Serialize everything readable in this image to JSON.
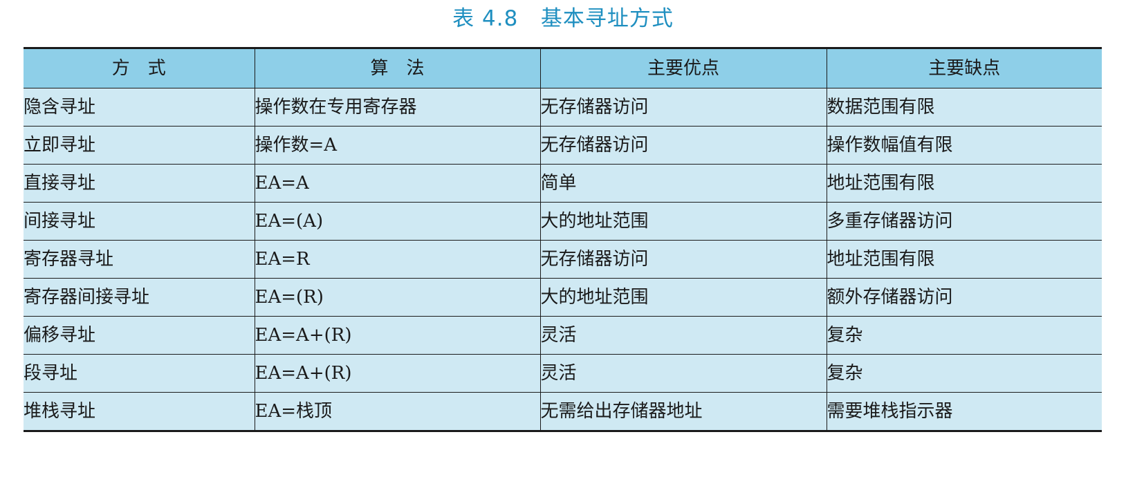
{
  "caption": "表 4.8   基本寻址方式",
  "table": {
    "headers": [
      "方　式",
      "算　法",
      "主要优点",
      "主要缺点"
    ],
    "rows": [
      [
        "隐含寻址",
        "操作数在专用寄存器",
        "无存储器访问",
        "数据范围有限"
      ],
      [
        "立即寻址",
        "操作数=A",
        "无存储器访问",
        "操作数幅值有限"
      ],
      [
        "直接寻址",
        "EA=A",
        "简单",
        "地址范围有限"
      ],
      [
        "间接寻址",
        "EA=(A)",
        "大的地址范围",
        "多重存储器访问"
      ],
      [
        "寄存器寻址",
        "EA=R",
        "无存储器访问",
        "地址范围有限"
      ],
      [
        "寄存器间接寻址",
        "EA=(R)",
        "大的地址范围",
        "额外存储器访问"
      ],
      [
        "偏移寻址",
        "EA=A+(R)",
        "灵活",
        "复杂"
      ],
      [
        "段寻址",
        "EA=A+(R)",
        "灵活",
        "复杂"
      ],
      [
        "堆栈寻址",
        "EA=栈顶",
        "无需给出存储器地址",
        "需要堆栈指示器"
      ]
    ]
  },
  "colors": {
    "caption": "#1f8fc0",
    "header_bg": "#8ecfe8",
    "row_bg": "#cfe9f3",
    "rule": "#1a1a1a"
  }
}
